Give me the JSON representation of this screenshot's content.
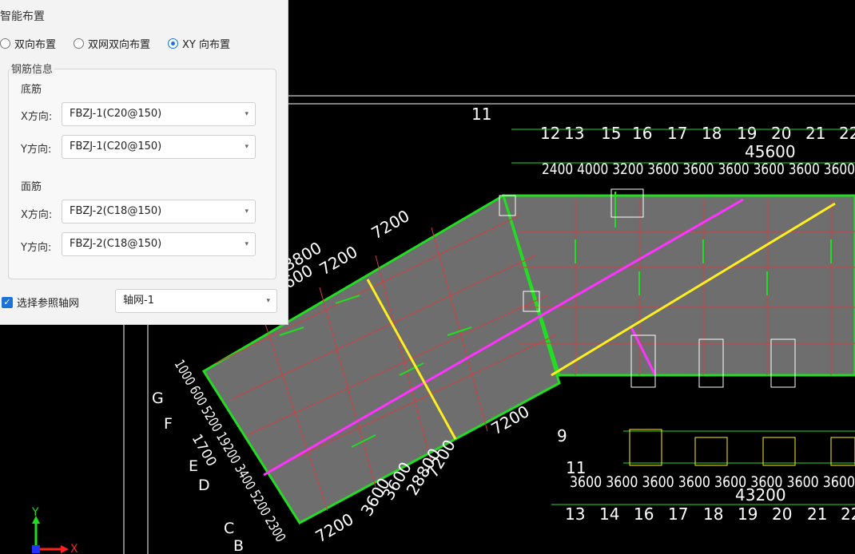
{
  "panel": {
    "title": "智能布置",
    "layout_options": [
      {
        "label": "双向布置",
        "selected": false
      },
      {
        "label": "双网双向布置",
        "selected": false
      },
      {
        "label": "XY 向布置",
        "selected": true
      }
    ],
    "group_title": "钢筋信息",
    "bottom": {
      "title": "底筋",
      "x_label": "X方向:",
      "x_value": "FBZJ-1(C20@150)",
      "y_label": "Y方向:",
      "y_value": "FBZJ-1(C20@150)"
    },
    "top": {
      "title": "面筋",
      "x_label": "X方向:",
      "x_value": "FBZJ-2(C18@150)",
      "y_label": "Y方向:",
      "y_value": "FBZJ-2(C18@150)"
    },
    "ref_grid": {
      "label": "选择参照轴网",
      "checked": true,
      "value": "轴网-1"
    }
  },
  "cad": {
    "top_axis_labels": [
      "12",
      "13",
      "15",
      "16",
      "17",
      "18",
      "19",
      "20",
      "21",
      "22"
    ],
    "top_total": "45600",
    "top_spans": "2400 4000 3200 3600 3600 3600 3600 3600 3600",
    "bottom_axis_labels": [
      "13",
      "14",
      "16",
      "17",
      "18",
      "19",
      "20",
      "21",
      "22"
    ],
    "bottom_total": "43200",
    "bottom_spans": "3600 3600 3600 3600 3600 3600 3600 3600",
    "axis_11_top": "11",
    "axis_11_mid": "11",
    "axis_9": "9",
    "left_dims": [
      "7200",
      "7200",
      "3800",
      "600"
    ],
    "bottom_dims": [
      "7200",
      "3600",
      "3600",
      "28800",
      "7200",
      "7200"
    ],
    "left_letters": [
      "G",
      "F",
      "E",
      "D",
      "C",
      "B"
    ],
    "left_side_nums": "1000 600 5200 19200 3400 5200 2300",
    "side_label_small": "1700",
    "ucs_y": "Y",
    "ucs_x": "X",
    "colors": {
      "slab": "#6e6e6e",
      "rebar_green": "#22dd22",
      "magenta": "#ff33ff",
      "yellow": "#ffee22",
      "axis_white": "#ffffff"
    }
  }
}
